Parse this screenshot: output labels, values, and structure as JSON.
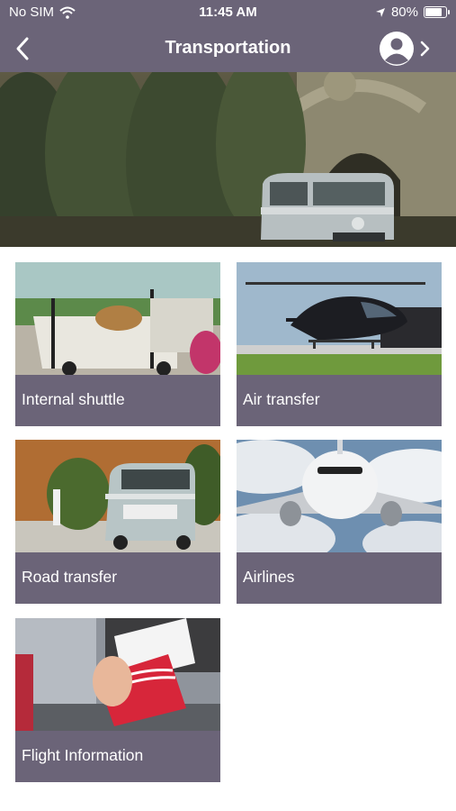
{
  "status_bar": {
    "carrier": "No SIM",
    "time": "11:45 AM",
    "battery": "80%",
    "battery_level": 0.8,
    "icons": [
      "wifi-icon",
      "location-arrow-icon",
      "battery-icon"
    ]
  },
  "nav": {
    "title": "Transportation",
    "back_icon": "chevron-left-icon",
    "profile_icon": "user-circle-icon",
    "forward_icon": "chevron-right-icon"
  },
  "colors": {
    "bar": "#6b6478",
    "tile": "#6b6478",
    "text": "#ffffff",
    "background": "#ffffff"
  },
  "tiles": [
    {
      "label": "Internal shuttle",
      "image": "golf-cart-photo"
    },
    {
      "label": "Air transfer",
      "image": "helicopter-photo"
    },
    {
      "label": "Road transfer",
      "image": "vw-van-photo"
    },
    {
      "label": "Airlines",
      "image": "airplane-photo"
    },
    {
      "label": "Flight Information",
      "image": "boarding-pass-photo"
    }
  ]
}
